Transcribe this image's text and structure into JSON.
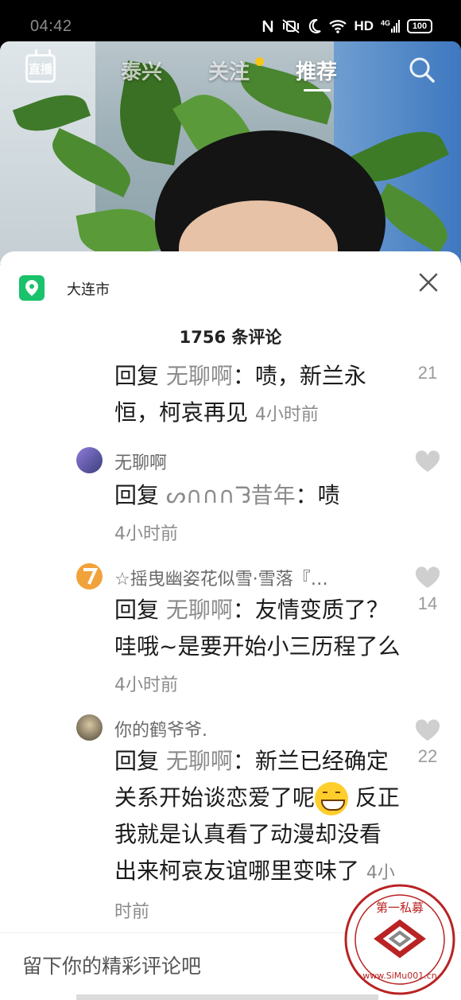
{
  "status_bar": {
    "time": "04:42",
    "network": "HD",
    "signal_type": "4G",
    "battery": "100"
  },
  "top_nav": {
    "live_label": "直播",
    "tabs": [
      {
        "label": "泰兴",
        "active": false
      },
      {
        "label": "关注",
        "active": false,
        "has_dot": true
      },
      {
        "label": "推荐",
        "active": true
      }
    ],
    "search_icon": "search-icon"
  },
  "sheet": {
    "location": "大连市",
    "comment_count": "1756 条评论",
    "comments": [
      {
        "nickname": "",
        "reply_prefix": "回复 ",
        "reply_to": "无聊啊",
        "text": "：啧，新兰永恒，柯哀再见 ",
        "time": "4小时前",
        "likes": "21"
      },
      {
        "nickname": "无聊啊",
        "reply_prefix": "回复 ",
        "reply_to": "ᔕ∩∩∩ᘊ昔年",
        "text": "：啧",
        "time": "4小时前",
        "likes": ""
      },
      {
        "nickname": "☆摇曳幽姿花似雪·雪落『…",
        "reply_prefix": "回复 ",
        "reply_to": "无聊啊",
        "text": "：友情变质了？哇哦~是要开始小三历程了么 ",
        "time": "4小时前",
        "likes": "14"
      },
      {
        "nickname": "你的鹤爷爷.",
        "reply_prefix": "回复 ",
        "reply_to": "无聊啊",
        "text": "：新兰已经确定关系开始谈恋爱了呢",
        "text2": " 反正我就是认真看了动漫却没看出来柯哀友谊哪里变味了 ",
        "time": "4小时前",
        "likes": "22"
      }
    ]
  },
  "input": {
    "placeholder": "留下你的精彩评论吧"
  },
  "watermark": {
    "top_text": "第一私募",
    "bottom_text": "www.SiMu001.cn"
  }
}
